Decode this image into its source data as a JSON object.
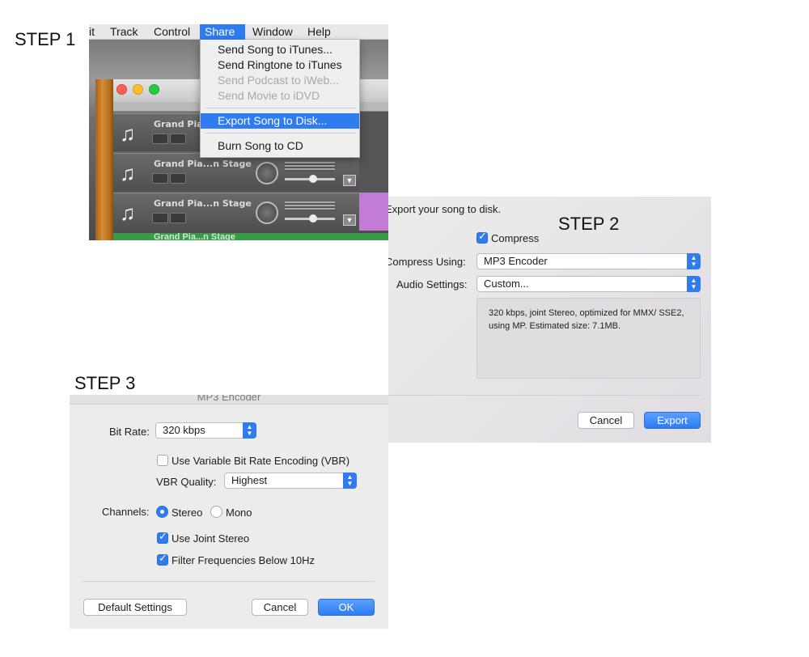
{
  "labels": {
    "step1": "STEP 1",
    "step2": "STEP 2",
    "step3": "STEP 3"
  },
  "step1": {
    "menubar": [
      "it",
      "Track",
      "Control",
      "Share",
      "Window",
      "Help"
    ],
    "active_menu": "Share",
    "share_menu": {
      "send_song": "Send Song to iTunes...",
      "send_ringtone": "Send Ringtone to iTunes",
      "send_podcast": "Send Podcast to iWeb...",
      "send_movie": "Send Movie to iDVD",
      "export_song": "Export Song to Disk...",
      "burn_song": "Burn Song to CD"
    },
    "tracks": [
      {
        "name": "Grand Pia"
      },
      {
        "name": "Grand Pia...n Stage"
      },
      {
        "name": "Grand Pia...n Stage"
      }
    ],
    "partial_track": "Grand Pia...n Stage"
  },
  "step2": {
    "heading": "Export your song to disk.",
    "compress_label": "Compress",
    "compress_checked": true,
    "compress_using_label": "Compress Using:",
    "compress_using_value": "MP3 Encoder",
    "audio_settings_label": "Audio Settings:",
    "audio_settings_value": "Custom...",
    "info": "320 kbps, joint Stereo, optimized for MMX/ SSE2, using MP. Estimated size: 7.1MB.",
    "cancel": "Cancel",
    "export": "Export"
  },
  "step3": {
    "title": "MP3 Encoder",
    "bit_rate_label": "Bit Rate:",
    "bit_rate_value": "320 kbps",
    "vbr_label": "Use Variable Bit Rate Encoding (VBR)",
    "vbr_checked": false,
    "vbr_quality_label": "VBR Quality:",
    "vbr_quality_value": "Highest",
    "channels_label": "Channels:",
    "stereo_label": "Stereo",
    "mono_label": "Mono",
    "selected_channel": "Stereo",
    "joint_stereo_label": "Use Joint Stereo",
    "joint_stereo_checked": true,
    "filter_label": "Filter Frequencies Below 10Hz",
    "filter_checked": true,
    "default_settings": "Default Settings",
    "cancel": "Cancel",
    "ok": "OK"
  },
  "colors": {
    "accent": "#2f7cf0",
    "menu_bg": "#efefef",
    "disabled_text": "#a8a8a8"
  }
}
